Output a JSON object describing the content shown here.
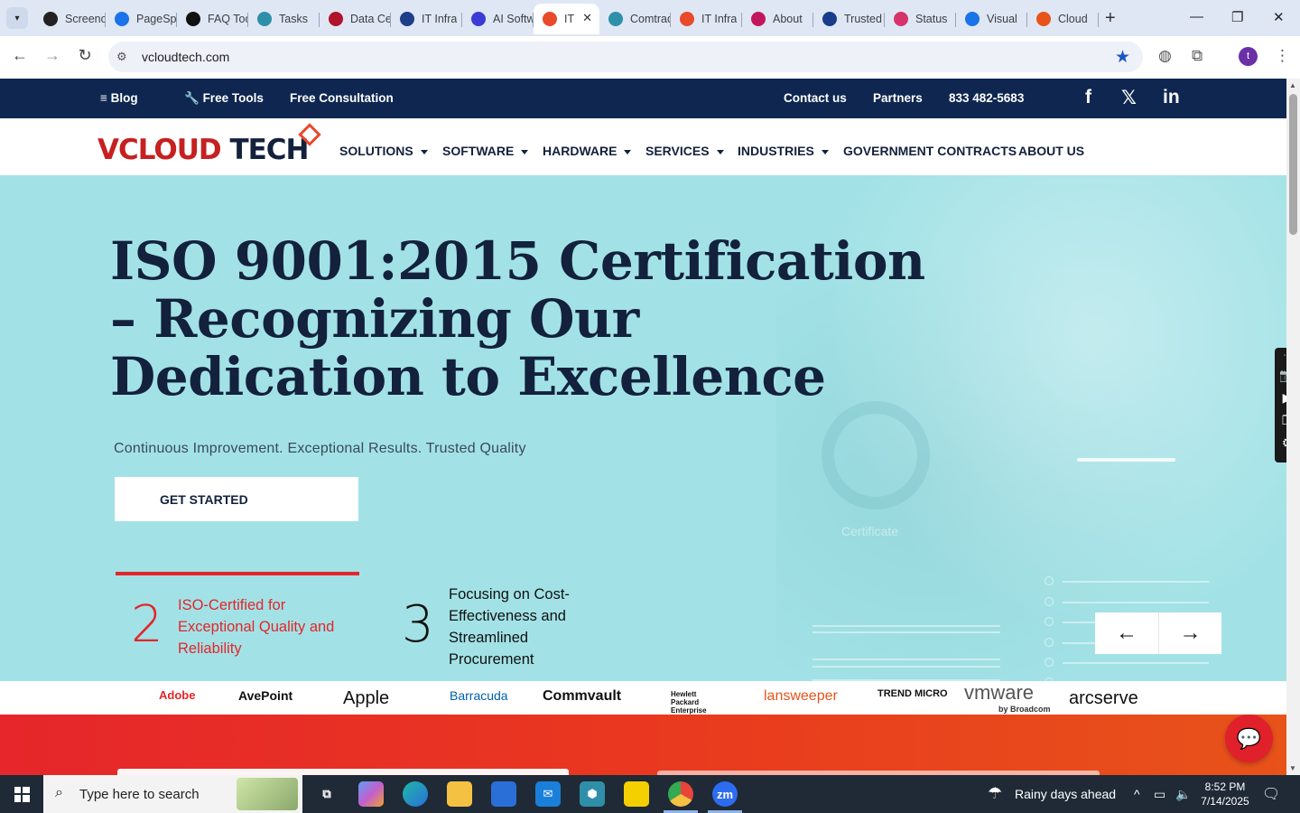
{
  "browser": {
    "tabs": [
      {
        "title": "Screencast",
        "icon": "screencast-icon",
        "color": "#222222"
      },
      {
        "title": "PageSpeed",
        "icon": "pagespeed-icon",
        "color": "#1a73e8"
      },
      {
        "title": "FAQ Tool",
        "icon": "openai-icon",
        "color": "#111111"
      },
      {
        "title": "Tasks",
        "icon": "hexagon-icon",
        "color": "#2f8fa8"
      },
      {
        "title": "Data Center",
        "icon": "v-icon",
        "color": "#b0132b"
      },
      {
        "title": "IT Infra",
        "icon": "check-flag-icon",
        "color": "#1d3f8a"
      },
      {
        "title": "AI Software",
        "icon": "x-logo-icon",
        "color": "#3b3bd6"
      },
      {
        "title": "IT",
        "icon": "vcloud-diamond-icon",
        "color": "#e84a2a",
        "active": true
      },
      {
        "title": "Comtrade",
        "icon": "hexagon-icon",
        "color": "#2f8fa8"
      },
      {
        "title": "IT Infra",
        "icon": "vcloud-diamond-icon",
        "color": "#e84a2a"
      },
      {
        "title": "About",
        "icon": "pinwheel-icon",
        "color": "#c2185b"
      },
      {
        "title": "Trusted",
        "icon": "scales-icon",
        "color": "#1a3c8a"
      },
      {
        "title": "Status",
        "icon": "feather-icon",
        "color": "#d6336c"
      },
      {
        "title": "Visual",
        "icon": "pulse-icon",
        "color": "#1a73e8"
      },
      {
        "title": "Cloud",
        "icon": "swoosh-icon",
        "color": "#e8531a"
      }
    ],
    "url": "vcloudtech.com"
  },
  "site": {
    "topbar": {
      "blog": "Blog",
      "free_tools": "Free Tools",
      "free_consultation": "Free Consultation",
      "contact": "Contact us",
      "partners": "Partners",
      "phone": "833 482-5683",
      "social": [
        "f",
        "𝕏",
        "in"
      ]
    },
    "logo": {
      "v": "V",
      "c1": "CLOUD",
      "c2": "TECH"
    },
    "nav": [
      {
        "label": "SOLUTIONS",
        "dropdown": true
      },
      {
        "label": "SOFTWARE",
        "dropdown": true
      },
      {
        "label": "HARDWARE",
        "dropdown": true
      },
      {
        "label": "SERVICES",
        "dropdown": true
      },
      {
        "label": "INDUSTRIES",
        "dropdown": true
      },
      {
        "label": "GOVERNMENT CONTRACTS",
        "dropdown": false
      },
      {
        "label": "ABOUT US",
        "dropdown": false
      }
    ],
    "hero": {
      "title": "ISO 9001:2015 Certification – Recognizing Our Dedication to Excellence",
      "subtitle": "Continuous Improvement. Exceptional Results. Trusted Quality",
      "cta": "GET STARTED",
      "art_label": "Certificate",
      "stats": [
        {
          "num": "2",
          "text": "ISO-Certified for Exceptional Quality and Reliability",
          "color": "#e2262a"
        },
        {
          "num": "3",
          "text": "Focusing on Cost-Effectiveness and Streamlined Procurement",
          "color": "#111111"
        }
      ],
      "prev": "←",
      "next": "→"
    },
    "partners": [
      {
        "name": "Adobe",
        "color": "#e2262a"
      },
      {
        "name": "AvePoint",
        "color": "#111111"
      },
      {
        "name": "Apple",
        "color": "#111111"
      },
      {
        "name": "Barracuda",
        "color": "#0060a8"
      },
      {
        "name": "Commvault",
        "color": "#111111"
      },
      {
        "name": "Hewlett Packard Enterprise",
        "color": "#111111"
      },
      {
        "name": "lansweeper",
        "color": "#e8531a"
      },
      {
        "name": "TREND MICRO",
        "color": "#111111"
      },
      {
        "name": "vmware",
        "color": "#555555"
      },
      {
        "name": "by Broadcom",
        "color": "#333333"
      },
      {
        "name": "arcserve",
        "color": "#111111"
      }
    ]
  },
  "taskbar": {
    "search_placeholder": "Type here to search",
    "weather": "Rainy days ahead",
    "time": "8:52 PM",
    "date": "7/14/2025"
  },
  "colors": {
    "navy": "#0f2750",
    "hero_bg": "#a2e2e6",
    "brand_red": "#e2262a"
  }
}
